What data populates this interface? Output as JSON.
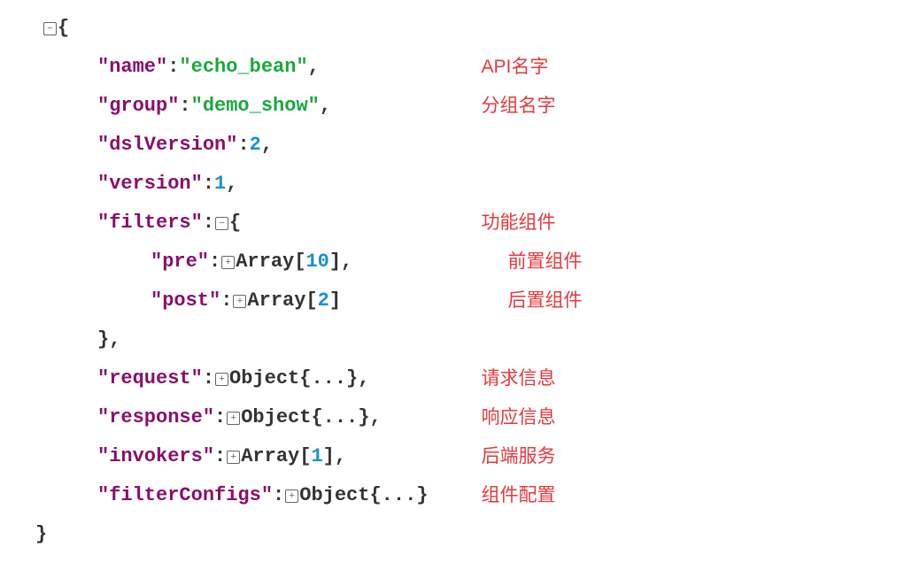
{
  "json": {
    "openBrace": "{",
    "closeBrace": "}",
    "colon": ":",
    "comma": ",",
    "name": {
      "key": "\"name\"",
      "value": "\"echo_bean\""
    },
    "group": {
      "key": "\"group\"",
      "value": "\"demo_show\""
    },
    "dslVersion": {
      "key": "\"dslVersion\"",
      "value": "2"
    },
    "version": {
      "key": "\"version\"",
      "value": "1"
    },
    "filters": {
      "key": "\"filters\""
    },
    "pre": {
      "key": "\"pre\"",
      "arrayLabel": "Array[",
      "count": "10",
      "close": "]"
    },
    "post": {
      "key": "\"post\"",
      "arrayLabel": "Array[",
      "count": "2",
      "close": "]"
    },
    "request": {
      "key": "\"request\"",
      "objLabel": "Object{...}"
    },
    "response": {
      "key": "\"response\"",
      "objLabel": "Object{...}"
    },
    "invokers": {
      "key": "\"invokers\"",
      "arrayLabel": "Array[",
      "count": "1",
      "close": "]"
    },
    "filterConfigs": {
      "key": "\"filterConfigs\"",
      "objLabel": "Object{...}"
    },
    "toggleExpand": "−",
    "toggleCollapse": "+"
  },
  "annotations": {
    "name": "API名字",
    "group": "分组名字",
    "filters": "功能组件",
    "pre": "前置组件",
    "post": "后置组件",
    "request": "请求信息",
    "response": "响应信息",
    "invokers": "后端服务",
    "filterConfigs": "组件配置"
  }
}
